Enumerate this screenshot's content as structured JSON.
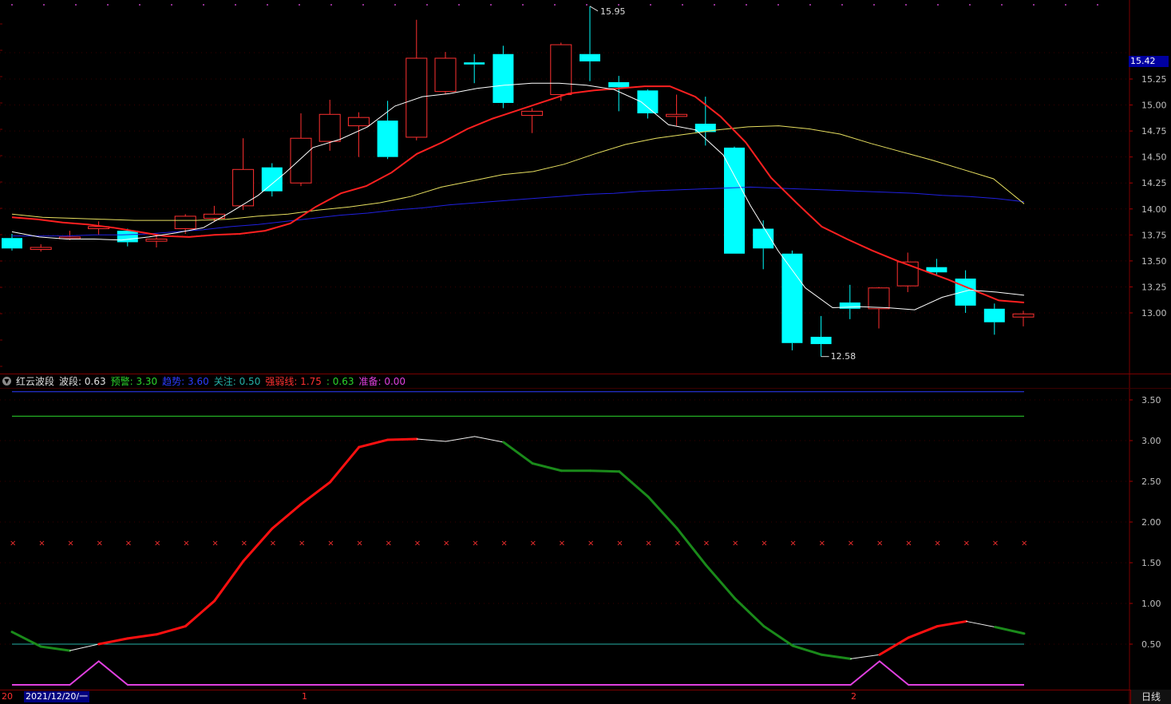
{
  "legend": {
    "name": "红云波段",
    "items": [
      {
        "label": "波段:",
        "value": "0.63",
        "color": "#e0e0e0"
      },
      {
        "label": "预警:",
        "value": "3.30",
        "color": "#2bd42b"
      },
      {
        "label": "趋势:",
        "value": "3.60",
        "color": "#2c3cff"
      },
      {
        "label": "关注:",
        "value": "0.50",
        "color": "#26b0a6"
      },
      {
        "label": "强弱线:",
        "value": "1.75",
        "color": "#ff3030"
      },
      {
        "label": ":",
        "value": "0.63",
        "color": "#2bd42b"
      },
      {
        "label": "准备:",
        "value": "0.00",
        "color": "#e040e0"
      }
    ]
  },
  "markers": {
    "high": "15.95",
    "low": "12.58"
  },
  "current_price": "15.42",
  "date_left": "20",
  "date_label": "2021/12/20/一",
  "month_ticks": [
    "1",
    "2"
  ],
  "period_button": "日线",
  "colors": {
    "up": "#ff3030",
    "down": "#00ffff",
    "ma5": "#ffffff",
    "ma10": "#ff2020",
    "ma20": "#e8e060",
    "ma60": "#2020e0"
  },
  "chart_data": [
    {
      "type": "candlestick",
      "yticks": [
        "15.25",
        "15.00",
        "14.75",
        "14.50",
        "14.25",
        "14.00",
        "13.75",
        "13.50",
        "13.25",
        "13.00"
      ],
      "candles": [
        {
          "o": 13.72,
          "c": 13.62,
          "h": 13.76,
          "l": 13.6
        },
        {
          "o": 13.61,
          "c": 13.63,
          "h": 13.66,
          "l": 13.59
        },
        {
          "o": 13.72,
          "c": 13.73,
          "h": 13.79,
          "l": 13.7
        },
        {
          "o": 13.81,
          "c": 13.83,
          "h": 13.88,
          "l": 13.75
        },
        {
          "o": 13.79,
          "c": 13.68,
          "h": 13.81,
          "l": 13.64
        },
        {
          "o": 13.69,
          "c": 13.71,
          "h": 13.76,
          "l": 13.63
        },
        {
          "o": 13.81,
          "c": 13.93,
          "h": 13.95,
          "l": 13.76
        },
        {
          "o": 13.91,
          "c": 13.95,
          "h": 14.03,
          "l": 13.88
        },
        {
          "o": 14.03,
          "c": 14.38,
          "h": 14.68,
          "l": 13.99
        },
        {
          "o": 14.4,
          "c": 14.17,
          "h": 14.44,
          "l": 14.12
        },
        {
          "o": 14.25,
          "c": 14.68,
          "h": 14.92,
          "l": 14.22
        },
        {
          "o": 14.65,
          "c": 14.91,
          "h": 15.05,
          "l": 14.56
        },
        {
          "o": 14.8,
          "c": 14.88,
          "h": 14.93,
          "l": 14.5
        },
        {
          "o": 14.85,
          "c": 14.5,
          "h": 15.04,
          "l": 14.48
        },
        {
          "o": 14.69,
          "c": 15.45,
          "h": 15.82,
          "l": 14.66
        },
        {
          "o": 15.13,
          "c": 15.45,
          "h": 15.51,
          "l": 15.1
        },
        {
          "o": 15.41,
          "c": 15.39,
          "h": 15.49,
          "l": 15.21
        },
        {
          "o": 15.49,
          "c": 15.02,
          "h": 15.57,
          "l": 14.97
        },
        {
          "o": 14.9,
          "c": 14.94,
          "h": 14.97,
          "l": 14.73
        },
        {
          "o": 15.1,
          "c": 15.58,
          "h": 15.6,
          "l": 15.04
        },
        {
          "o": 15.49,
          "c": 15.42,
          "h": 15.95,
          "l": 15.23
        },
        {
          "o": 15.22,
          "c": 15.17,
          "h": 15.28,
          "l": 14.94
        },
        {
          "o": 15.14,
          "c": 14.92,
          "h": 15.15,
          "l": 14.87
        },
        {
          "o": 14.89,
          "c": 14.91,
          "h": 15.1,
          "l": 14.8
        },
        {
          "o": 14.82,
          "c": 14.74,
          "h": 15.08,
          "l": 14.61
        },
        {
          "o": 14.59,
          "c": 13.57,
          "h": 14.6,
          "l": 13.57
        },
        {
          "o": 13.81,
          "c": 13.62,
          "h": 13.89,
          "l": 13.42
        },
        {
          "o": 13.57,
          "c": 12.71,
          "h": 13.6,
          "l": 12.64
        },
        {
          "o": 12.77,
          "c": 12.7,
          "h": 12.97,
          "l": 12.58
        },
        {
          "o": 13.1,
          "c": 13.04,
          "h": 13.27,
          "l": 12.94
        },
        {
          "o": 13.04,
          "c": 13.24,
          "h": 13.25,
          "l": 12.85
        },
        {
          "o": 13.26,
          "c": 13.49,
          "h": 13.58,
          "l": 13.2
        },
        {
          "o": 13.44,
          "c": 13.39,
          "h": 13.52,
          "l": 13.37
        },
        {
          "o": 13.33,
          "c": 13.07,
          "h": 13.41,
          "l": 13.0
        },
        {
          "o": 13.04,
          "c": 12.91,
          "h": 13.09,
          "l": 12.79
        },
        {
          "o": 12.96,
          "c": 12.99,
          "h": 13.02,
          "l": 12.87
        }
      ],
      "ma5": [
        13.78,
        13.73,
        13.71,
        13.71,
        13.7,
        13.73,
        13.77,
        13.82,
        13.97,
        14.13,
        14.35,
        14.59,
        14.67,
        14.79,
        14.99,
        15.08,
        15.11,
        15.16,
        15.19,
        15.21,
        15.21,
        15.19,
        15.15,
        15.03,
        14.81,
        14.76,
        14.52,
        14.03,
        13.6,
        13.24,
        13.05,
        13.06,
        13.05,
        13.03,
        13.15,
        13.22,
        13.2,
        13.17
      ],
      "ma10": [
        13.92,
        13.9,
        13.87,
        13.85,
        13.82,
        13.78,
        13.74,
        13.73,
        13.75,
        13.76,
        13.79,
        13.86,
        14.02,
        14.15,
        14.22,
        14.35,
        14.53,
        14.64,
        14.77,
        14.87,
        14.95,
        15.03,
        15.11,
        15.14,
        15.16,
        15.18,
        15.18,
        15.08,
        14.89,
        14.64,
        14.3,
        14.06,
        13.83,
        13.71,
        13.6,
        13.5,
        13.41,
        13.32,
        13.22,
        13.12,
        13.1
      ],
      "ma20": [
        13.95,
        13.92,
        13.91,
        13.9,
        13.89,
        13.89,
        13.89,
        13.9,
        13.93,
        13.95,
        13.99,
        14.02,
        14.06,
        14.12,
        14.21,
        14.27,
        14.33,
        14.36,
        14.43,
        14.53,
        14.62,
        14.68,
        14.72,
        14.76,
        14.79,
        14.8,
        14.77,
        14.72,
        14.63,
        14.55,
        14.47,
        14.38,
        14.29,
        14.05
      ],
      "ma60": [
        13.74,
        13.74,
        13.74,
        13.75,
        13.75,
        13.76,
        13.78,
        13.8,
        13.83,
        13.85,
        13.88,
        13.91,
        13.94,
        13.96,
        13.99,
        14.01,
        14.04,
        14.06,
        14.08,
        14.1,
        14.12,
        14.14,
        14.15,
        14.17,
        14.18,
        14.19,
        14.2,
        14.21,
        14.2,
        14.19,
        14.18,
        14.17,
        14.16,
        14.15,
        14.13,
        14.12,
        14.1,
        14.07
      ]
    },
    {
      "type": "line",
      "yticks": [
        "3.50",
        "3.00",
        "2.50",
        "2.00",
        "1.50",
        "1.00",
        "0.50"
      ],
      "bodo": [
        0.65,
        0.47,
        0.42,
        0.5,
        0.57,
        0.62,
        0.72,
        1.03,
        1.52,
        1.92,
        2.22,
        2.49,
        2.92,
        3.01,
        3.02,
        2.99,
        3.05,
        2.98,
        2.72,
        2.63,
        2.63,
        2.62,
        2.31,
        1.92,
        1.47,
        1.06,
        0.72,
        0.48,
        0.37,
        0.32,
        0.37,
        0.58,
        0.72,
        0.78,
        0.71,
        0.63
      ],
      "zhunbei": [
        0.0,
        0.0,
        0.0,
        0.29,
        0.0,
        0.0,
        0.0,
        0.0,
        0.0,
        0.0,
        0.0,
        0.0,
        0.0,
        0.0,
        0.0,
        0.0,
        0.0,
        0.0,
        0.0,
        0.0,
        0.0,
        0.0,
        0.0,
        0.0,
        0.0,
        0.0,
        0.0,
        0.0,
        0.0,
        0.0,
        0.29,
        0.0,
        0.0,
        0.0,
        0.0,
        0.0
      ],
      "yujing": 3.3,
      "qushi": 3.6,
      "guanzhu": 0.5,
      "qiangruo": 1.75
    }
  ]
}
